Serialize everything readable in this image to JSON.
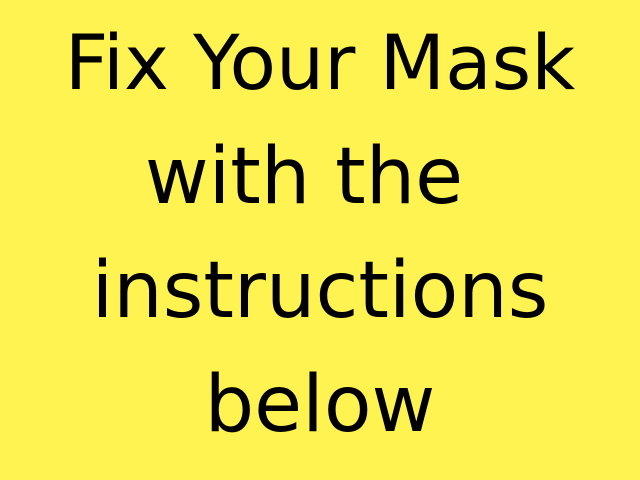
{
  "background_color": "#fff351",
  "text_color": "#000000",
  "headline": {
    "line1": "Fix Your Mask",
    "line2": "with the",
    "line3": "instructions",
    "line4": "below"
  }
}
